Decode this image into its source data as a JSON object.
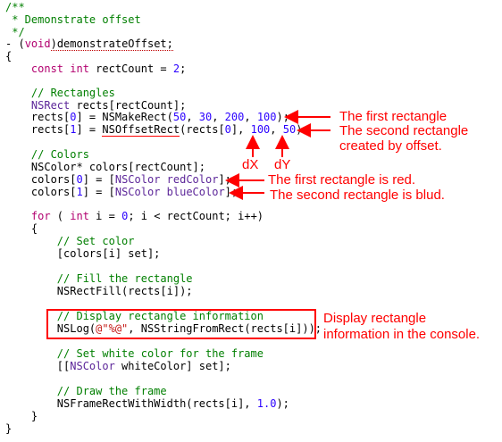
{
  "code_lines": {
    "l0": "/**",
    "l1": " * Demonstrate offset",
    "l2": " */",
    "l3a": "- (",
    "l3b": "void",
    "l3c": ")demonstrateOffset;",
    "l4": "{",
    "l5a": "    const int",
    "l5b": " rectCount = ",
    "l5c": "2",
    "l5d": ";",
    "l7": "    // Rectangles",
    "l8a": "    NSRect",
    "l8b": " rects[rectCount];",
    "l9a": "    rects[",
    "l9b": "0",
    "l9c": "] = NSMakeRect(",
    "l9d": "50",
    "l9e": ", ",
    "l9f": "30",
    "l9g": ", ",
    "l9h": "200",
    "l9i": ", ",
    "l9j": "100",
    "l9k": ");",
    "l10a": "    rects[",
    "l10b": "1",
    "l10c": "] = ",
    "l10d": "NSOffsetRect",
    "l10e": "(rects[",
    "l10f": "0",
    "l10g": "], ",
    "l10h": "100",
    "l10i": ", ",
    "l10j": "50",
    "l10k": ");",
    "l12": "    // Colors",
    "l13": "    NSColor* colors[rectCount];",
    "l14a": "    colors[",
    "l14b": "0",
    "l14c": "] = [",
    "l14d": "NSColor",
    "l14e": " redColor",
    "l14f": "];",
    "l15a": "    colors[",
    "l15b": "1",
    "l15c": "] = [",
    "l15d": "NSColor",
    "l15e": " blueColor",
    "l15f": "];",
    "l17a": "    for",
    "l17b": " ( ",
    "l17c": "int",
    "l17d": " i = ",
    "l17e": "0",
    "l17f": "; i < rectCount; i++)",
    "l18": "    {",
    "l19": "        // Set color",
    "l20": "        [colors[i] set];",
    "l22": "        // Fill the rectangle",
    "l23": "        NSRectFill(rects[i]);",
    "l25": "        // Display rectangle information",
    "l26a": "        NSLog(",
    "l26b": "@\"%@\"",
    "l26c": ", NSStringFromRect(rects[i]));",
    "l28": "        // Set white color for the frame",
    "l29a": "        [[",
    "l29b": "NSColor",
    "l29c": " whiteColor] set];",
    "l31": "        // Draw the frame",
    "l32a": "        NSFrameRectWithWidth(rects[i], ",
    "l32b": "1.0",
    "l32c": ");",
    "l33": "    }",
    "l34": "}"
  },
  "annotations": {
    "first_rect": "The first rectangle",
    "second_rect_1": "The second rectangle",
    "second_rect_2": "created by offset.",
    "dx": "dX",
    "dy": "dY",
    "red": "The first rectangle is red.",
    "blue": "The second rectangle is blud.",
    "display_1": "Display rectangle",
    "display_2": "information in the console."
  },
  "colors": {
    "annotation": "#ff0000",
    "comment": "#007f00",
    "keyword": "#b2006f",
    "type": "#5c2699",
    "number": "#2a00ff"
  }
}
